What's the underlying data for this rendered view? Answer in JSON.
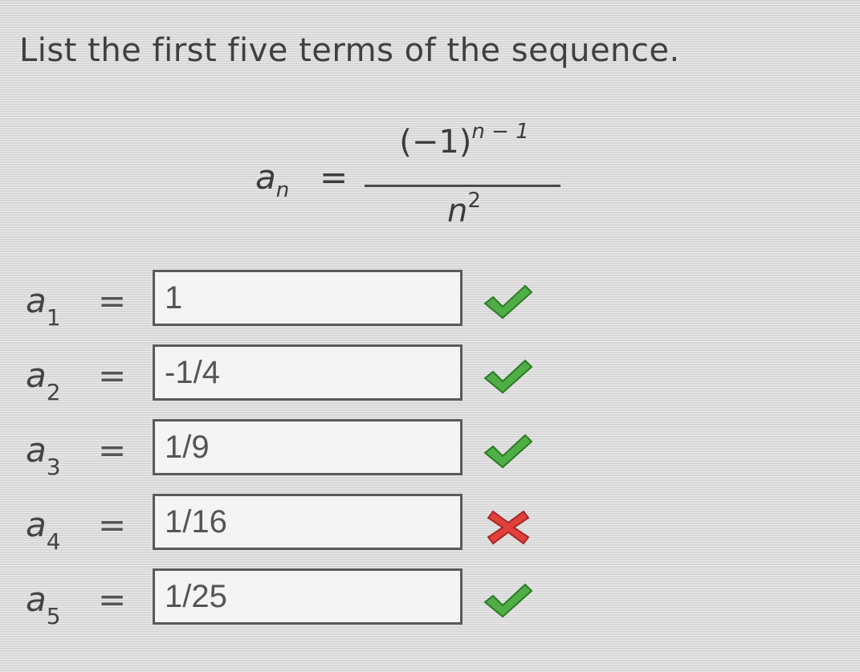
{
  "question": "List the first five terms of the sequence.",
  "formula": {
    "lhs": "a",
    "lhs_sub": "n",
    "equals": "=",
    "numerator": "(−1)",
    "numerator_exp": "n − 1",
    "denominator": "n",
    "denominator_exp": "2"
  },
  "terms": [
    {
      "label": "a",
      "sub": "1",
      "equals": "=",
      "value": "1",
      "status": "correct"
    },
    {
      "label": "a",
      "sub": "2",
      "equals": "=",
      "value": "-1/4",
      "status": "correct"
    },
    {
      "label": "a",
      "sub": "3",
      "equals": "=",
      "value": "1/9",
      "status": "correct"
    },
    {
      "label": "a",
      "sub": "4",
      "equals": "=",
      "value": "1/16",
      "status": "incorrect"
    },
    {
      "label": "a",
      "sub": "5",
      "equals": "=",
      "value": "1/25",
      "status": "correct"
    }
  ],
  "colors": {
    "correct": "#4fae46",
    "incorrect": "#e0403c"
  }
}
